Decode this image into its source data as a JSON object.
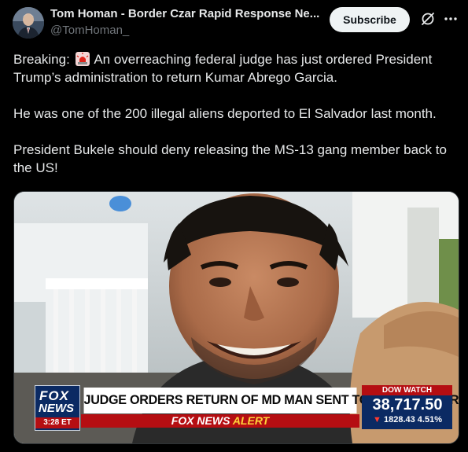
{
  "post": {
    "author_name": "Tom Homan - Border Czar Rapid Response Ne...",
    "author_handle": "@TomHoman_",
    "subscribe_label": "Subscribe",
    "paragraph1_prefix": "Breaking: ",
    "paragraph1_suffix": " An overreaching federal judge has just ordered President Trump’s administration to return Kumar Abrego Garcia.",
    "paragraph2": "He was one of the 200 illegal aliens deported to El Salvador last month.",
    "paragraph3": "President Bukele should deny releasing the MS-13 gang member back to the US!",
    "emoji_icon": "rotating-light-icon"
  },
  "media": {
    "fox_logo_top": "FOX",
    "fox_logo_bottom": "NEWS",
    "time": "3:28 ET",
    "headline": "JUDGE ORDERS RETURN OF MD MAN SENT TO EL SALVADOR",
    "alert_brand": "FOX NEWS",
    "alert_word": "ALERT",
    "dow_label": "DOW WATCH",
    "dow_value": "38,717.50",
    "dow_change": "1828.43 4.51%"
  },
  "colors": {
    "background": "#000000",
    "text": "#e7e9ea",
    "secondary_text": "#71767b",
    "fox_red": "#b50e12",
    "fox_navy": "#0b2a63"
  }
}
